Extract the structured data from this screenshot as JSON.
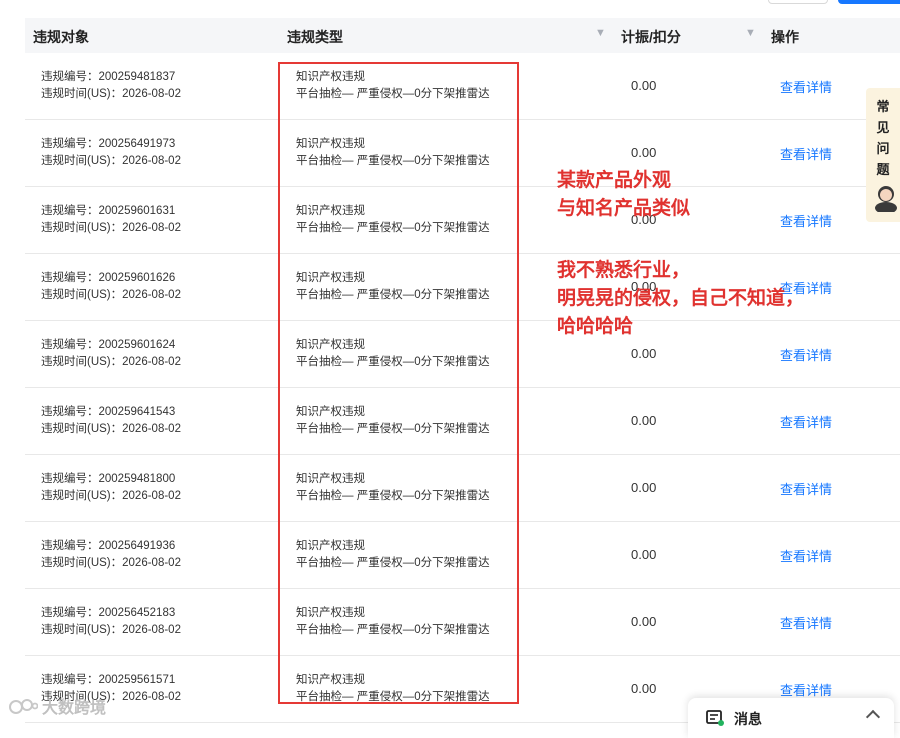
{
  "table": {
    "headers": {
      "object": "违规对象",
      "type": "违规类型",
      "score": "计振/扣分",
      "action": "操作"
    },
    "rows": [
      {
        "id_line": "违规编号：200259481837",
        "time_line": "违规时间(US)：2026-08-02",
        "type_main": "知识产权违规",
        "type_detail": "平台抽检— 严重侵权—0分下架推雷达",
        "score": "0.00",
        "action": "查看详情"
      },
      {
        "id_line": "违规编号：200256491973",
        "time_line": "违规时间(US)：2026-08-02",
        "type_main": "知识产权违规",
        "type_detail": "平台抽检— 严重侵权—0分下架推雷达",
        "score": "0.00",
        "action": "查看详情"
      },
      {
        "id_line": "违规编号：200259601631",
        "time_line": "违规时间(US)：2026-08-02",
        "type_main": "知识产权违规",
        "type_detail": "平台抽检— 严重侵权—0分下架推雷达",
        "score": "0.00",
        "action": "查看详情"
      },
      {
        "id_line": "违规编号：200259601626",
        "time_line": "违规时间(US)：2026-08-02",
        "type_main": "知识产权违规",
        "type_detail": "平台抽检— 严重侵权—0分下架推雷达",
        "score": "0.00",
        "action": "查看详情"
      },
      {
        "id_line": "违规编号：200259601624",
        "time_line": "违规时间(US)：2026-08-02",
        "type_main": "知识产权违规",
        "type_detail": "平台抽检— 严重侵权—0分下架推雷达",
        "score": "0.00",
        "action": "查看详情"
      },
      {
        "id_line": "违规编号：200259641543",
        "time_line": "违规时间(US)：2026-08-02",
        "type_main": "知识产权违规",
        "type_detail": "平台抽检— 严重侵权—0分下架推雷达",
        "score": "0.00",
        "action": "查看详情"
      },
      {
        "id_line": "违规编号：200259481800",
        "time_line": "违规时间(US)：2026-08-02",
        "type_main": "知识产权违规",
        "type_detail": "平台抽检— 严重侵权—0分下架推雷达",
        "score": "0.00",
        "action": "查看详情"
      },
      {
        "id_line": "违规编号：200256491936",
        "time_line": "违规时间(US)：2026-08-02",
        "type_main": "知识产权违规",
        "type_detail": "平台抽检— 严重侵权—0分下架推雷达",
        "score": "0.00",
        "action": "查看详情"
      },
      {
        "id_line": "违规编号：200256452183",
        "time_line": "违规时间(US)：2026-08-02",
        "type_main": "知识产权违规",
        "type_detail": "平台抽检— 严重侵权—0分下架推雷达",
        "score": "0.00",
        "action": "查看详情"
      },
      {
        "id_line": "违规编号：200259561571",
        "time_line": "违规时间(US)：2026-08-02",
        "type_main": "知识产权违规",
        "type_detail": "平台抽检— 严重侵权—0分下架推雷达",
        "score": "0.00",
        "action": "查看详情"
      }
    ]
  },
  "annotations": {
    "note1_line1": "某款产品外观",
    "note1_line2": "与知名产品类似",
    "note2_line1": "我不熟悉行业，",
    "note2_line2": "明晃晃的侵权，自己不知道，",
    "note2_line3": "哈哈哈哈"
  },
  "faq": {
    "label_chars": [
      "常",
      "见",
      "问",
      "题"
    ]
  },
  "message_panel": {
    "title": "消息"
  },
  "watermark": "大数跨境",
  "colors": {
    "link": "#1677ff",
    "annotation": "#e0322f",
    "header_bg": "#f5f6f8"
  },
  "icons": [
    "filter-icon",
    "message-icon",
    "chevron-up-icon",
    "avatar-icon"
  ]
}
